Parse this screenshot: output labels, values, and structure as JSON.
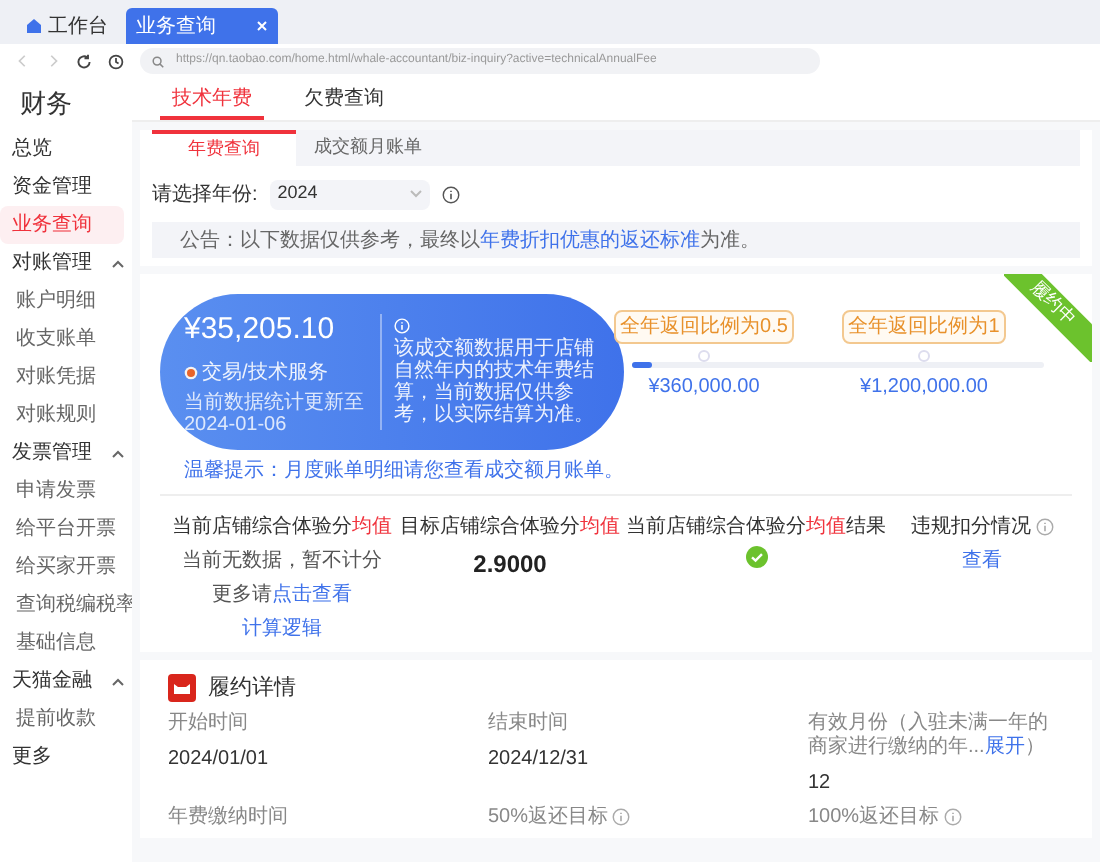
{
  "browser": {
    "tabs": [
      {
        "label": "工作台",
        "selected": false,
        "kind": "home"
      },
      {
        "label": "业务查询",
        "selected": true,
        "kind": "page"
      }
    ],
    "url": "https://qn.taobao.com/home.html/whale-accountant/biz-inquiry?active=technicalAnnualFee"
  },
  "app_title": "财务",
  "sidebar": {
    "items": [
      {
        "label": "总览",
        "selected": false
      },
      {
        "label": "资金管理",
        "selected": false
      },
      {
        "label": "业务查询",
        "selected": true
      },
      {
        "label": "对账管理",
        "selected": false,
        "expanded": true,
        "children": [
          {
            "label": "账户明细",
            "selected": false
          },
          {
            "label": "收支账单",
            "selected": false
          },
          {
            "label": "对账凭据",
            "selected": false
          },
          {
            "label": "对账规则",
            "selected": false
          }
        ]
      },
      {
        "label": "发票管理",
        "selected": false,
        "expanded": true,
        "children": [
          {
            "label": "申请发票",
            "selected": false
          },
          {
            "label": "给平台开票",
            "selected": false
          },
          {
            "label": "给买家开票",
            "selected": false
          },
          {
            "label": "查询税编税率",
            "selected": false
          },
          {
            "label": "基础信息",
            "selected": false
          }
        ]
      },
      {
        "label": "天猫金融",
        "selected": false,
        "expanded": true,
        "children": [
          {
            "label": "提前收款",
            "selected": false
          }
        ]
      },
      {
        "label": "更多",
        "selected": false
      }
    ]
  },
  "tabs": [
    {
      "label": "技术年费",
      "selected": true
    },
    {
      "label": "欠费查询",
      "selected": false
    }
  ],
  "subtabs": [
    {
      "label": "年费查询",
      "selected": true
    },
    {
      "label": "成交额月账单",
      "selected": false
    }
  ],
  "year_filter": {
    "label": "请选择年份:",
    "value": "2024"
  },
  "notice": [
    {
      "text": "公告：以下数据仅供参考，最终以",
      "kind": "text"
    },
    {
      "text": "年费折扣优惠的返还标准",
      "kind": "highlight"
    },
    {
      "text": "为准。",
      "kind": "text"
    }
  ],
  "summary": {
    "amount": "¥35,205.10",
    "badge": "交易/技术服务",
    "updated": "当前数据统计更新至 2024-01-06",
    "note": "该成交额数据用于店铺自然年内的技术年费结算，当前数据仅供参考，以实际结算为准。",
    "tip": "温馨提示：月度账单明细请您查看成交额月账单。"
  },
  "progress": {
    "level": 0.05,
    "milestones": [
      {
        "tag": "全年返回比例为0.5",
        "amount": "¥360,000.00"
      },
      {
        "tag": "全年返回比例为1",
        "amount": "¥1,200,000.00"
      }
    ]
  },
  "status_ribbon": "履约中",
  "metrics": [
    {
      "kind": "notes",
      "title": [
        {
          "text": "当前店铺综合体验分",
          "kind": "text"
        },
        {
          "text": "均值",
          "kind": "warning"
        }
      ],
      "lines": [
        [
          {
            "text": "当前无数据，暂不计分",
            "kind": "text"
          }
        ],
        [
          {
            "text": "更多请",
            "kind": "text"
          },
          {
            "text": "点击查看",
            "kind": "link"
          }
        ],
        [
          {
            "text": "计算逻辑",
            "kind": "link"
          }
        ]
      ]
    },
    {
      "kind": "value",
      "title": [
        {
          "text": "目标店铺综合体验分",
          "kind": "text"
        },
        {
          "text": "均值",
          "kind": "warning"
        }
      ],
      "value": "2.9000"
    },
    {
      "kind": "status",
      "title": [
        {
          "text": "当前店铺综合体验分",
          "kind": "text"
        },
        {
          "text": "均值",
          "kind": "warning"
        },
        {
          "text": "结果",
          "kind": "text"
        }
      ],
      "passed": true
    },
    {
      "kind": "action",
      "info": true,
      "title": [
        {
          "text": "违规扣分情况",
          "kind": "text"
        }
      ],
      "action": "查看"
    }
  ],
  "details": {
    "title": "履约详情",
    "fields": [
      {
        "label": [
          {
            "text": "开始时间",
            "kind": "text"
          }
        ],
        "value": "2024/01/01"
      },
      {
        "label": [
          {
            "text": "结束时间",
            "kind": "text"
          }
        ],
        "value": "2024/12/31"
      },
      {
        "label": [
          {
            "text": "有效月份（入驻未满一年的商家进行缴纳的年...",
            "kind": "text"
          },
          {
            "text": "展开",
            "kind": "link"
          },
          {
            "text": "）",
            "kind": "text"
          }
        ],
        "value": "12"
      },
      {
        "label": [
          {
            "text": "年费缴纳时间",
            "kind": "text"
          }
        ]
      },
      {
        "label": [
          {
            "text": "50%返还目标",
            "kind": "text"
          }
        ],
        "info": true
      },
      {
        "label": [
          {
            "text": "100%返还目标",
            "kind": "text"
          }
        ],
        "info": true
      }
    ]
  }
}
